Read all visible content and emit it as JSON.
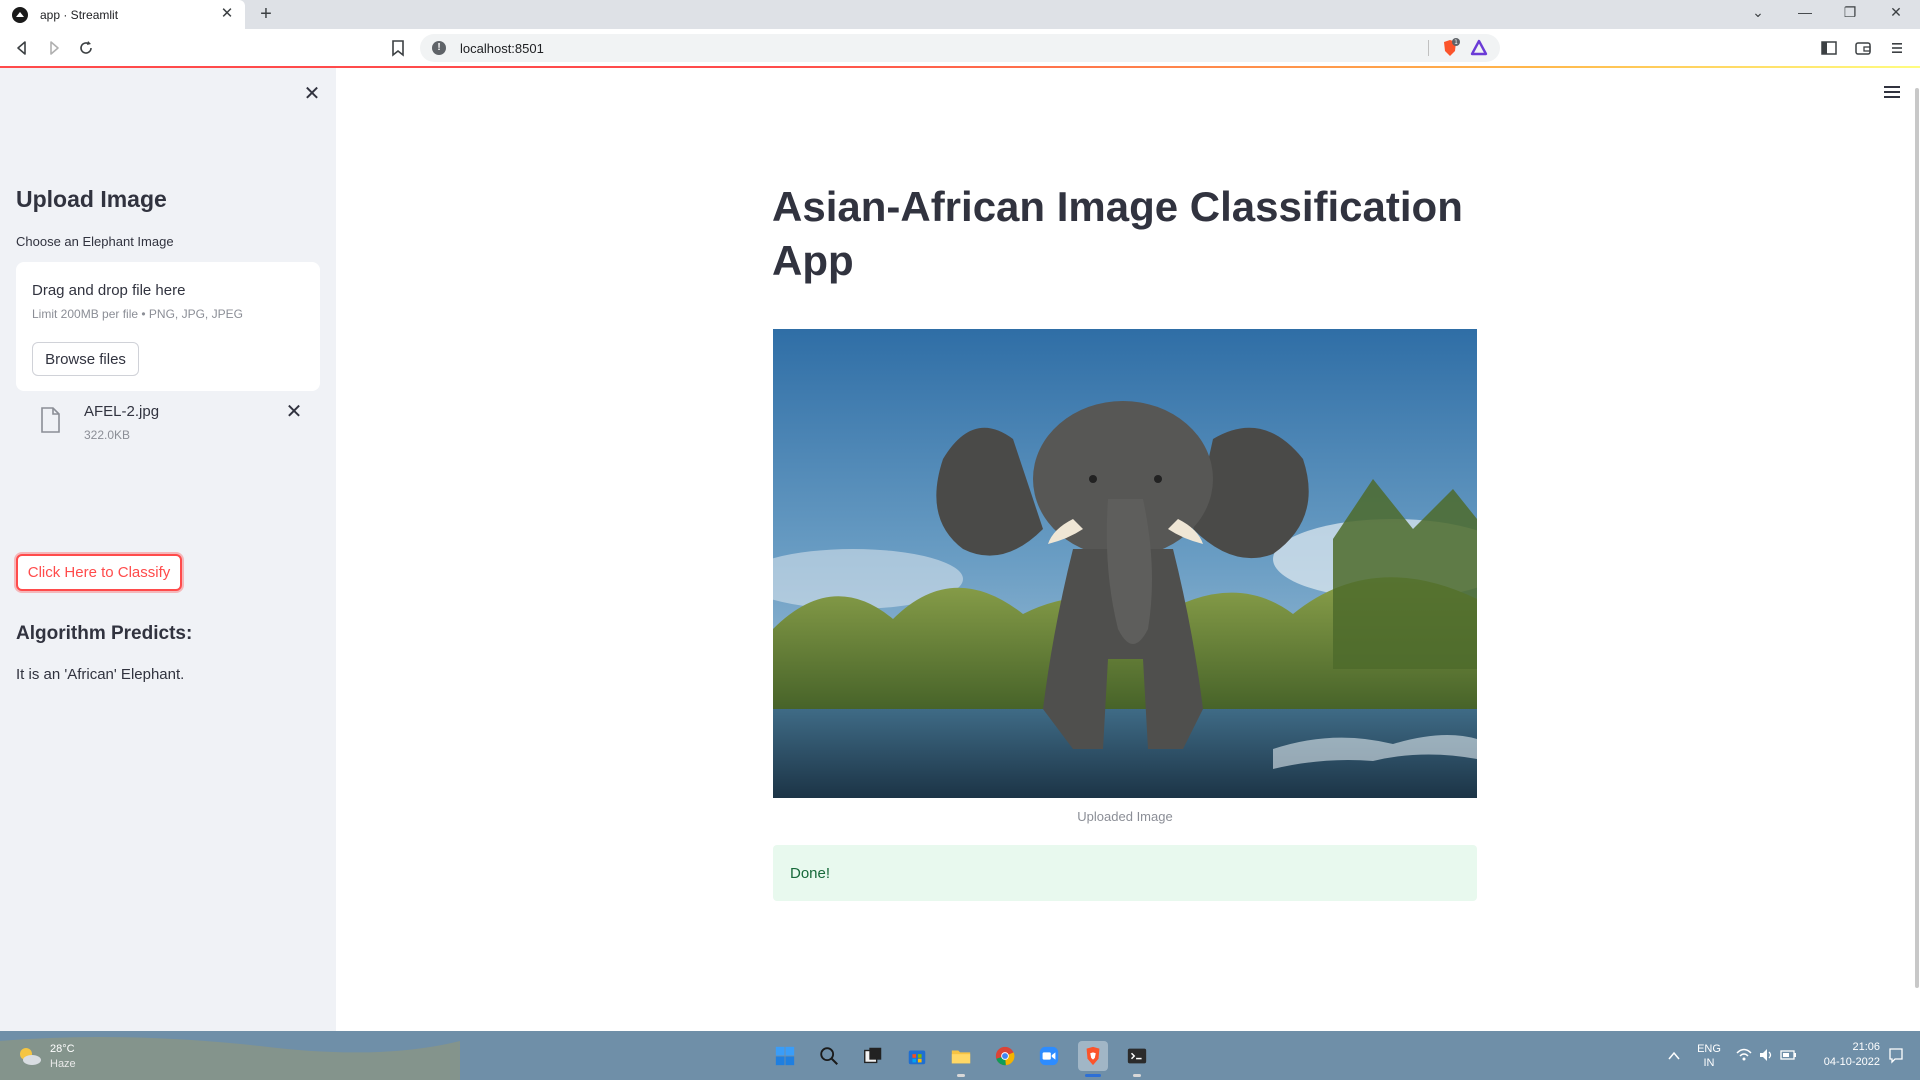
{
  "browser": {
    "tab_title": "app · Streamlit",
    "url": "localhost:8501",
    "shield_count": "1"
  },
  "sidebar": {
    "heading": "Upload Image",
    "uploader_label": "Choose an Elephant Image",
    "dropzone_title": "Drag and drop file here",
    "dropzone_limit": "Limit 200MB per file • PNG, JPG, JPEG",
    "browse_label": "Browse files",
    "file_name": "AFEL-2.jpg",
    "file_size": "322.0KB",
    "classify_label": "Click Here to Classify",
    "predict_heading": "Algorithm Predicts:",
    "predict_text": "It is an 'African' Elephant."
  },
  "main": {
    "title": "Asian-African Image Classification App",
    "image_caption": "Uploaded Image",
    "success_text": "Done!"
  },
  "taskbar": {
    "weather_temp": "28°C",
    "weather_desc": "Haze",
    "lang_line1": "ENG",
    "lang_line2": "IN",
    "time": "21:06",
    "date": "04-10-2022"
  },
  "colors": {
    "accent": "#ff4b4b",
    "sidebar_bg": "#f0f2f6",
    "success_bg": "#e8f9ee",
    "success_text": "#17693a"
  }
}
